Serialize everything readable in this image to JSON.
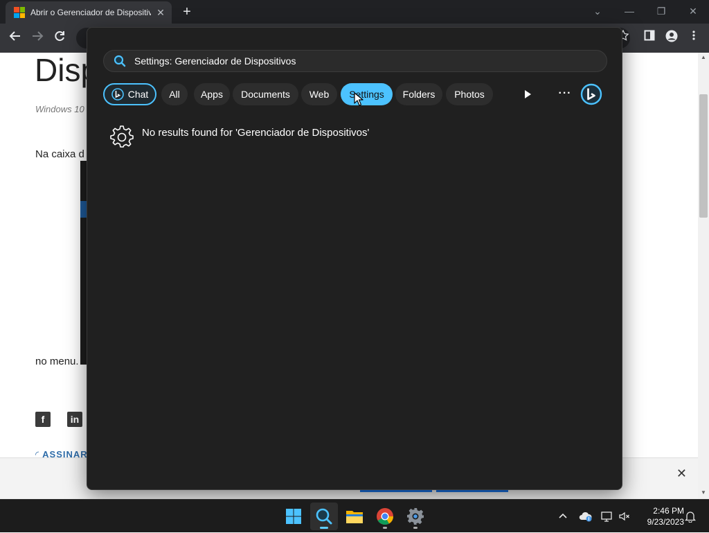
{
  "browser": {
    "tab_title": "Abrir o Gerenciador de Dispositivos",
    "tab_close": "✕",
    "new_tab": "+",
    "window_controls": {
      "dropdown": "⌄",
      "minimize": "—",
      "restore": "❐",
      "close": "✕"
    }
  },
  "page": {
    "heading": "Disp",
    "meta": "Windows 10",
    "para1": "Na caixa d",
    "para2": "no menu.",
    "social": [
      "f",
      "in"
    ],
    "subscribe": "ASSINAR",
    "banner_close": "✕"
  },
  "search": {
    "query": "Settings: Gerenciador de Dispositivos",
    "chips": [
      {
        "label": "Chat"
      },
      {
        "label": "All"
      },
      {
        "label": "Apps"
      },
      {
        "label": "Documents"
      },
      {
        "label": "Web"
      },
      {
        "label": "Settings",
        "active": true
      },
      {
        "label": "Folders"
      },
      {
        "label": "Photos"
      }
    ],
    "more_label": "···",
    "result_message": "No results found for 'Gerenciador de Dispositivos'",
    "accent": "#4cc2ff"
  },
  "taskbar": {
    "apps": [
      "windows-start-icon",
      "search-icon",
      "file-explorer-icon",
      "chrome-icon",
      "settings-icon"
    ],
    "time": "2:46 PM",
    "date": "9/23/2023"
  }
}
